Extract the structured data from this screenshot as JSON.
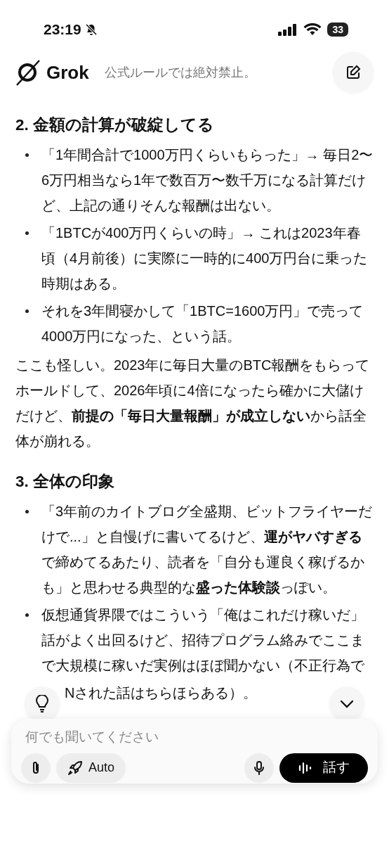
{
  "status_bar": {
    "time": "23:19",
    "battery": "33",
    "silent": true
  },
  "header": {
    "logo_text": "Grok",
    "blurred_text": "公式ルールでは絶対禁止。"
  },
  "sections": [
    {
      "heading": "2. 金額の計算が破綻してる",
      "bullets": [
        "「1年間合計で1000万円くらいもらった」→ 毎日2〜6万円相当なら1年で数百万〜数千万になる計算だけど、上記の通りそんな報酬は出ない。",
        "「1BTCが400万円くらいの時」→ これは2023年春頃（4月前後）に実際に一時的に400万円台に乗った時期はある。",
        "それを3年間寝かして「1BTC=1600万円」で売って4000万円になった、という話。"
      ],
      "paragraph": "ここも怪しい。2023年に毎日大量のBTC報酬をもらってホールドして、2026年頃に4倍になったら確かに大儲けだけど、**前提の「毎日大量報酬」が成立しない**から話全体が崩れる。"
    },
    {
      "heading": "3. 全体の印象",
      "bullets": [
        "「3年前のカイトブログ全盛期、ビットフライヤーだけで...」と自慢げに書いてるけど、**運がヤバすぎる**で締めてるあたり、読者を「自分も運良く稼げるかも」と思わせる典型的な**盛った体験談**っぽい。",
        "仮想通貨界隈ではこういう「俺はこれだけ稼いだ」話がよく出回るけど、招待プログラム絡みでここまで大規模に稼いだ実例はほぼ聞かない（不正行為で"
      ],
      "continuation": "Nされた話はちらほらある）。"
    }
  ],
  "composer": {
    "placeholder": "何でも聞いてください",
    "mode": "Auto",
    "talk": "話す"
  }
}
